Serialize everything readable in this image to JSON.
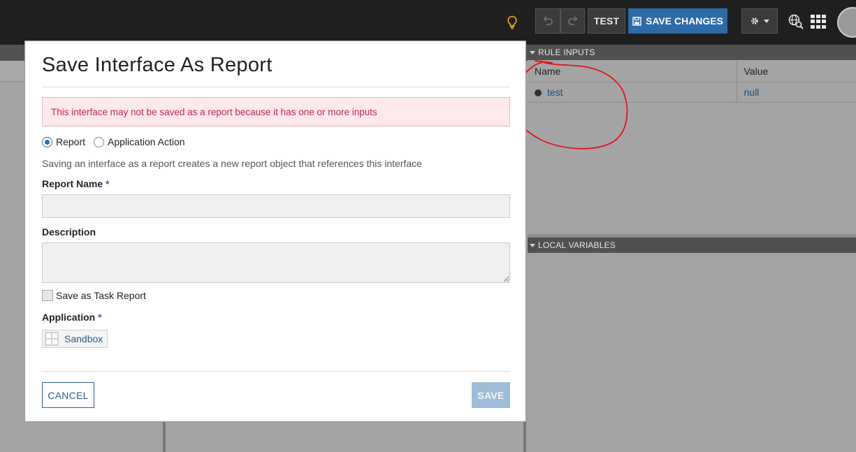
{
  "toolbar": {
    "test_label": "TEST",
    "save_changes_label": "SAVE CHANGES"
  },
  "rule_inputs": {
    "header": "RULE INPUTS",
    "columns": [
      "Name",
      "Value"
    ],
    "rows": [
      {
        "name": "test",
        "value": "null"
      }
    ]
  },
  "local_variables": {
    "header": "LOCAL VARIABLES"
  },
  "dialog": {
    "title": "Save Interface As Report",
    "error_message": "This interface may not be saved as a report because it has one or more inputs",
    "type_options": [
      {
        "label": "Report",
        "selected": true
      },
      {
        "label": "Application Action",
        "selected": false
      }
    ],
    "help_text": "Saving an interface as a report creates a new report object that references this interface",
    "report_name_label": "Report Name",
    "report_name_value": "",
    "description_label": "Description",
    "description_value": "",
    "required_marker": "*",
    "task_report_label": "Save as Task Report",
    "task_report_checked": false,
    "application_label": "Application",
    "application_value": "Sandbox",
    "cancel_label": "CANCEL",
    "save_label": "SAVE"
  },
  "colors": {
    "primary": "#2d6aa8",
    "error_text": "#c0294d",
    "error_bg": "#fde8ec",
    "annotation": "#e0141e"
  }
}
